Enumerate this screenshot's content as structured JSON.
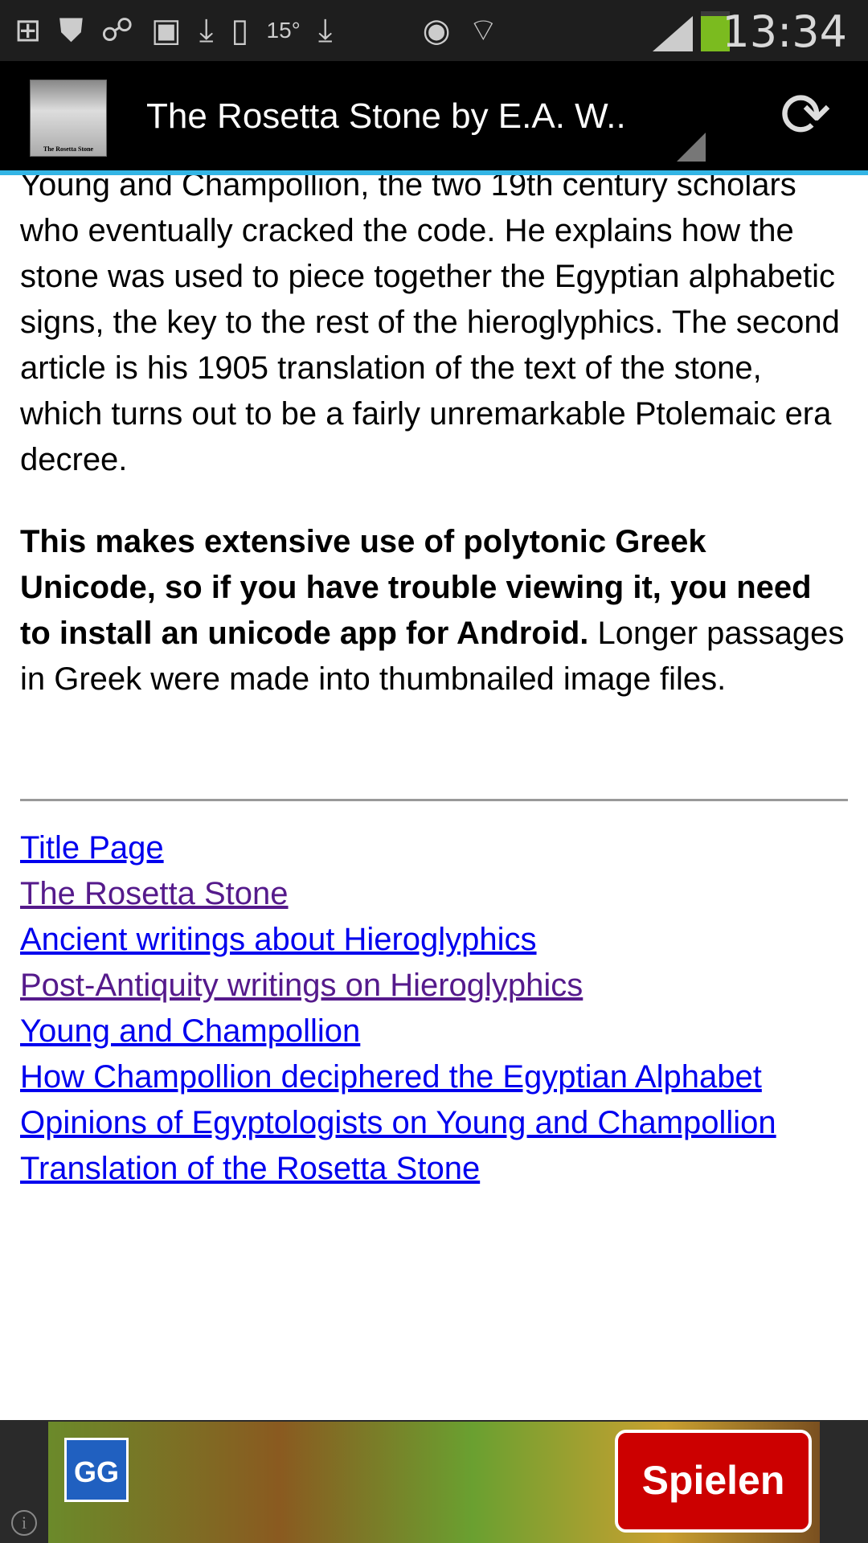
{
  "status_bar": {
    "time": "13:34",
    "temperature": "15°",
    "icons": [
      "plus-badge-icon",
      "shield-icon",
      "link-icon",
      "image-icon",
      "download-icon",
      "phone-check-icon",
      "download-icon",
      "eye-icon",
      "wifi-icon",
      "signal-icon",
      "battery-icon"
    ]
  },
  "app_bar": {
    "title": "The Rosetta Stone by E.A. W..",
    "icon_caption": "The Rosetta Stone",
    "accent_color": "#33b5e5"
  },
  "content": {
    "paragraph1": "Young and Champollion, the two 19th century scholars who eventually cracked the code. He explains how the stone was used to piece together the Egyptian alphabetic signs, the key to the rest of the hieroglyphics. The second article is his 1905 translation of the text of the stone, which turns out to be a fairly unremarkable Ptolemaic era decree.",
    "bold_note": "This makes extensive use of polytonic Greek Unicode, so if you have trouble viewing it, you need to install an unicode app for Android.",
    "note_rest": " Longer passages in Greek were made into thumbnailed image files.",
    "links": [
      {
        "label": "Title Page",
        "visited": false
      },
      {
        "label": "The Rosetta Stone",
        "visited": true
      },
      {
        "label": "Ancient writings about Hieroglyphics",
        "visited": false
      },
      {
        "label": "Post-Antiquity writings on Hieroglyphics",
        "visited": true
      },
      {
        "label": "Young and Champollion",
        "visited": false
      },
      {
        "label": "How Champollion deciphered the Egyptian Alphabet",
        "visited": false
      },
      {
        "label": "Opinions of Egyptologists on Young and Champollion",
        "visited": false
      },
      {
        "label": "Translation of the Rosetta Stone",
        "visited": false
      }
    ],
    "link_color": "#0000ee",
    "visited_color": "#551a8b"
  },
  "ad": {
    "logo": "GG",
    "button": "Spielen"
  }
}
